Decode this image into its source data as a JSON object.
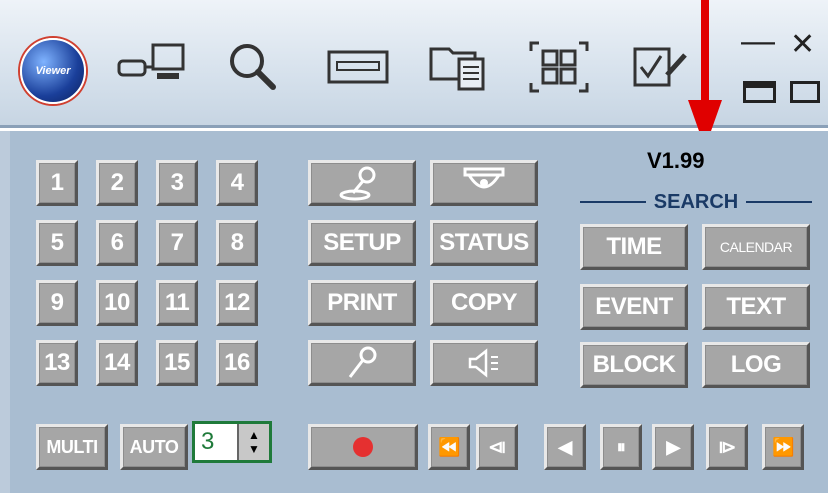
{
  "toolbar": {
    "logo_text": "Viewer",
    "buttons": [
      {
        "name": "network-icon"
      },
      {
        "name": "search-icon"
      },
      {
        "name": "dvr-icon"
      },
      {
        "name": "folder-icon"
      },
      {
        "name": "fullscreen-icon"
      },
      {
        "name": "checklist-icon"
      }
    ],
    "window_controls": {
      "minimize": "—",
      "close": "✕"
    }
  },
  "channels": [
    "1",
    "2",
    "3",
    "4",
    "5",
    "6",
    "7",
    "8",
    "9",
    "10",
    "11",
    "12",
    "13",
    "14",
    "15",
    "16"
  ],
  "multi_label": "MULTI",
  "auto_label": "AUTO",
  "auto_value": "3",
  "mid_buttons": {
    "setup": "SETUP",
    "status": "STATUS",
    "print": "PRINT",
    "copy": "COPY"
  },
  "version": "V1.99",
  "search": {
    "header": "SEARCH",
    "time": "TIME",
    "calendar": "CALENDAR",
    "event": "EVENT",
    "text": "TEXT",
    "block": "BLOCK",
    "log": "LOG"
  },
  "playback": {
    "rewind": "⏪",
    "step_back": "⧏",
    "reverse": "◀",
    "pause": "⏸",
    "play": "▶",
    "step_forward": "⧐",
    "fast_forward": "⏩"
  },
  "colors": {
    "record": "#e53030",
    "annotation_arrow": "#e00000"
  }
}
